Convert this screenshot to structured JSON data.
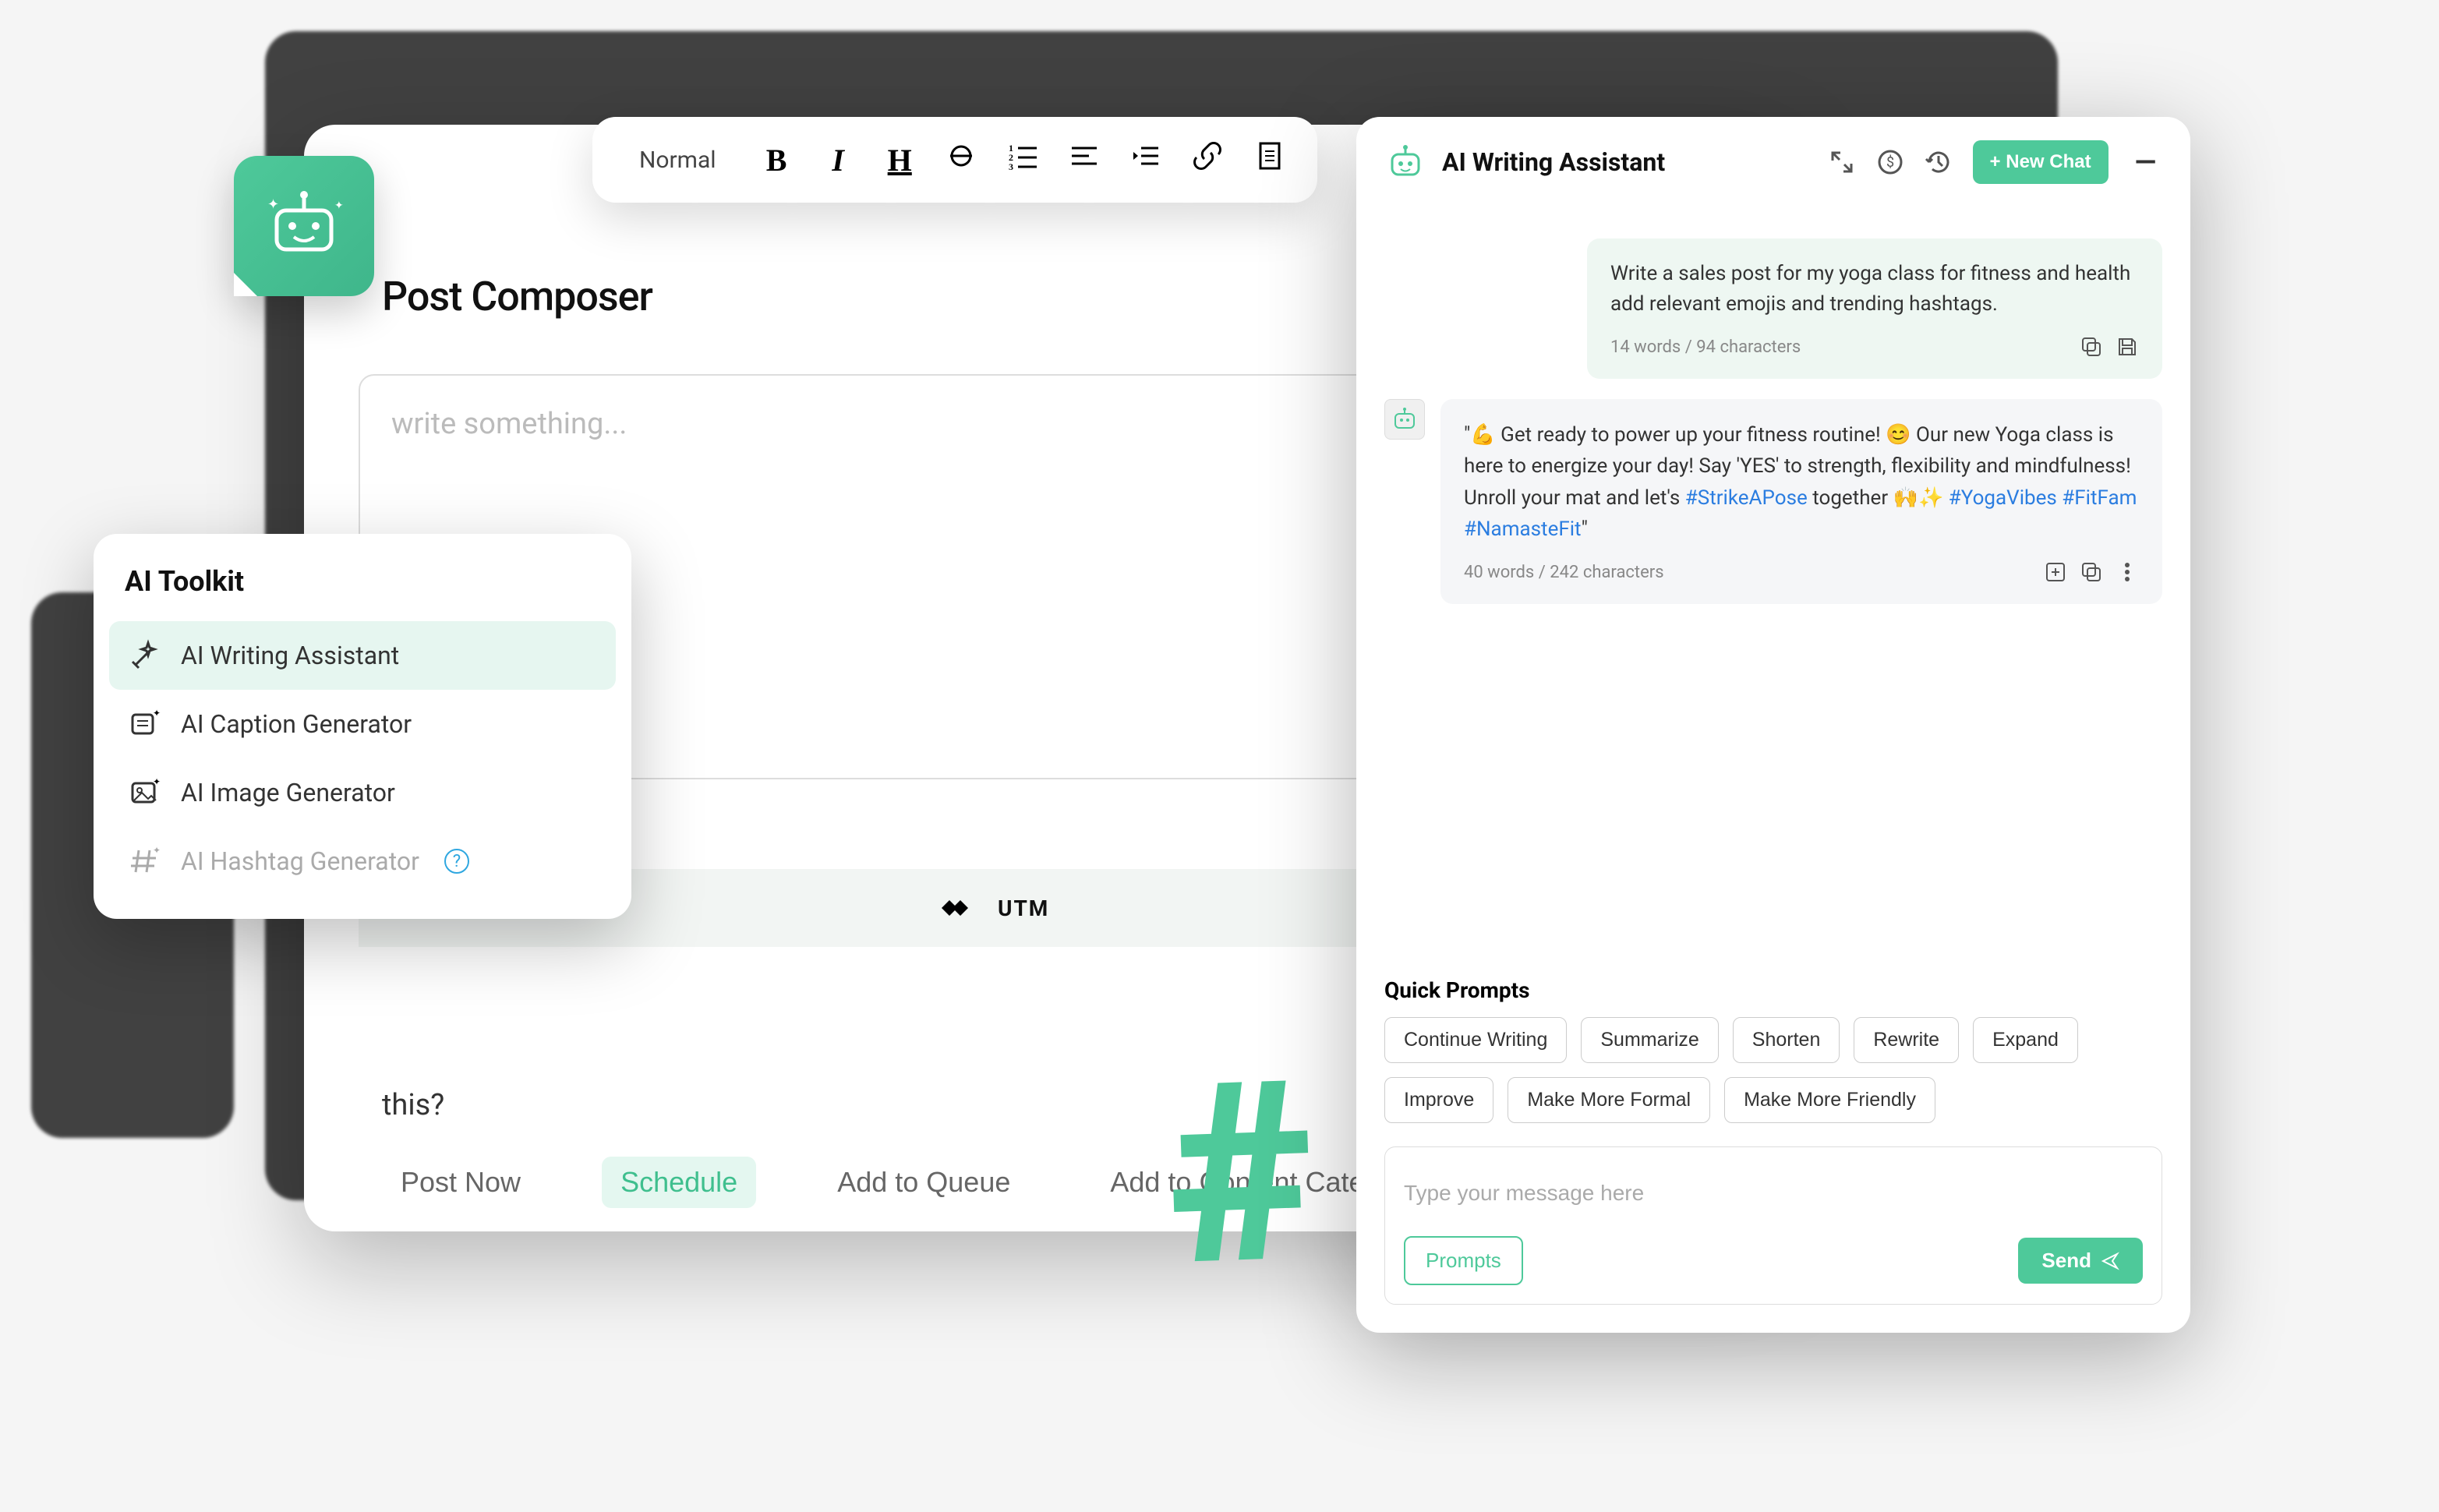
{
  "composer": {
    "title": "Post Composer",
    "placeholder": "write something...",
    "toolbar": {
      "format": "Normal"
    },
    "utm_label": "UTM",
    "this_label": "this?",
    "actions": {
      "post_now": "Post Now",
      "schedule": "Schedule",
      "add_to_queue": "Add to Queue",
      "add_to_category": "Add to Content Category"
    }
  },
  "toolkit": {
    "title": "AI Toolkit",
    "items": [
      {
        "label": "AI Writing Assistant",
        "active": true
      },
      {
        "label": "AI Caption Generator",
        "active": false
      },
      {
        "label": "AI Image Generator",
        "active": false
      },
      {
        "label": "AI Hashtag Generator",
        "active": false,
        "disabled": true
      }
    ]
  },
  "assistant": {
    "title": "AI Writing Assistant",
    "new_chat": "+ New Chat",
    "user_message": {
      "line1": "Write a sales post for my yoga class for fitness and health",
      "line2": "add relevant emojis and trending hashtags.",
      "stats": "14 words / 94 characters"
    },
    "ai_message": {
      "text_prefix": "\"💪 Get ready to power up your fitness routine! 😊 Our new Yoga class is here to energize your day! Say 'YES' to strength, flexibility and mindfulness!  Unroll your mat and let's ",
      "hashtag1": "#StrikeAPose",
      "text_mid": " together 🙌✨ ",
      "hashtag2": "#YogaVibes",
      "hashtag3": "#FitFam",
      "hashtag4": "#NamasteFit",
      "text_suffix": "\"",
      "stats": "40 words / 242 characters"
    },
    "quick_prompts": {
      "title": "Quick Prompts",
      "chips": [
        "Continue Writing",
        "Summarize",
        "Shorten",
        "Rewrite",
        "Expand",
        "Improve",
        "Make More Formal",
        "Make More Friendly"
      ]
    },
    "input": {
      "placeholder": "Type your message here",
      "prompts_btn": "Prompts",
      "send_btn": "Send"
    }
  }
}
